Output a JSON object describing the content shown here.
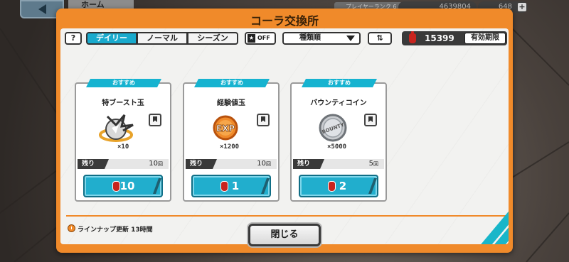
{
  "header": {
    "home_label": "ホーム",
    "rank_label": "プレイヤーランク",
    "rank_value": "6",
    "currency1": "4639804",
    "currency2": "648",
    "plus": "+"
  },
  "dialog": {
    "title": "コーラ交換所",
    "help": "?",
    "tabs": [
      {
        "label": "デイリー",
        "active": true
      },
      {
        "label": "ノーマル",
        "active": false
      },
      {
        "label": "シーズン",
        "active": false
      }
    ],
    "fav_filter": "OFF",
    "sort_label": "種類順",
    "order_icon": "⇅",
    "cola_count": "15399",
    "expiry_label": "有効期限"
  },
  "cards": [
    {
      "recommend": "おすすめ",
      "name": "特ブースト玉",
      "qty": "×10",
      "remain_label": "残り",
      "remain": "10",
      "remain_unit": "回",
      "price": "10",
      "icon": "boost-orb-icon"
    },
    {
      "recommend": "おすすめ",
      "name": "経験値玉",
      "qty": "×1200",
      "remain_label": "残り",
      "remain": "10",
      "remain_unit": "回",
      "price": "1",
      "icon": "exp-orb-icon"
    },
    {
      "recommend": "おすすめ",
      "name": "バウンティコイン",
      "qty": "×5000",
      "remain_label": "残り",
      "remain": "5",
      "remain_unit": "回",
      "price": "2",
      "icon": "bounty-coin-icon"
    }
  ],
  "footer": {
    "lineup_label": "ラインナップ更新",
    "lineup_time": "13時間",
    "close_label": "閉じる"
  },
  "colors": {
    "accent_orange": "#f08a2a",
    "accent_cyan": "#19aacd",
    "cola_red": "#c8241e"
  }
}
